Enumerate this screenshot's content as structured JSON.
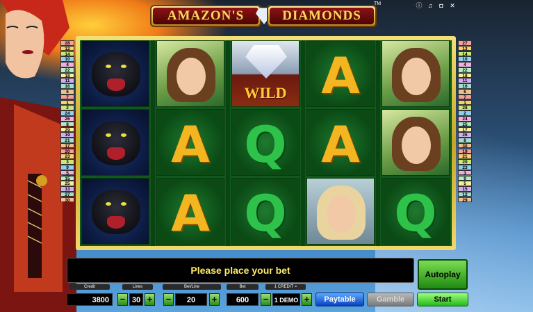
{
  "logo": {
    "left": "AMAZON'S",
    "right": "DIAMONDS",
    "tm": "TM"
  },
  "top_icons": [
    "info-icon",
    "sound-icon",
    "fullscreen-icon",
    "close-icon"
  ],
  "reels": [
    [
      "panther",
      "panther",
      "panther"
    ],
    [
      "girl",
      "A",
      "A"
    ],
    [
      "wild",
      "Q",
      "Q"
    ],
    [
      "A",
      "A",
      "blondie"
    ],
    [
      "girl",
      "girl",
      "Q"
    ]
  ],
  "wild_label": "WILD",
  "left_lines": [
    "28",
    "12",
    "14",
    "10",
    "4",
    "22",
    "18",
    "11",
    "16",
    "6",
    "7",
    "1",
    "2",
    "24",
    "26",
    "8",
    "29",
    "19",
    "21",
    "17",
    "20",
    "23",
    "3",
    "9",
    "5",
    "15",
    "25",
    "13",
    "27",
    "30"
  ],
  "right_lines": [
    "27",
    "13",
    "14",
    "10",
    "4",
    "22",
    "18",
    "11",
    "16",
    "6",
    "7",
    "1",
    "28",
    "2",
    "24",
    "25",
    "17",
    "26",
    "8",
    "30",
    "19",
    "21",
    "20",
    "23",
    "3",
    "9",
    "5",
    "15",
    "12",
    "29"
  ],
  "message": "Please place your bet",
  "autoplay_label": "Autoplay",
  "controls": {
    "credit_label": "Credit",
    "credit_value": "3800",
    "lines_label": "Lines",
    "lines_value": "30",
    "bet_line_label": "Bet/Line",
    "bet_line_value": "20",
    "bet_label": "Bet",
    "bet_value": "600",
    "denom_label": "1 CREDIT =",
    "denom_value": "1 DEMO",
    "minus": "−",
    "plus": "+",
    "paytable": "Paytable",
    "gamble": "Gamble",
    "start": "Start"
  },
  "colors": {
    "credit_field": "#000000",
    "start": "#24b81a",
    "paytable": "#0a40c0",
    "gamble": "#7a7a7a"
  }
}
